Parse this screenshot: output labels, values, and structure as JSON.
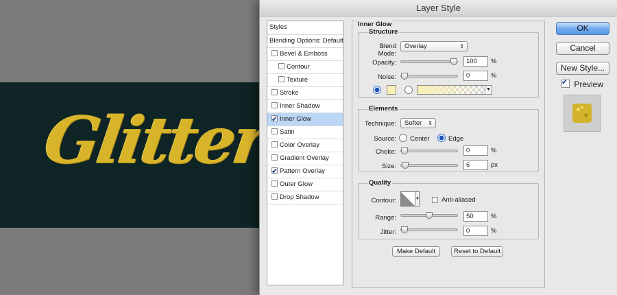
{
  "canvas": {
    "artwork_text": "Glitter",
    "doc_color": "#0f2424",
    "glitter_color": "#d8b42a"
  },
  "dialog": {
    "title": "Layer Style",
    "styles_panel": {
      "header": "Styles",
      "blending": "Blending Options: Default",
      "items": [
        {
          "label": "Bevel & Emboss",
          "checked": false,
          "sub": false,
          "selected": false
        },
        {
          "label": "Contour",
          "checked": false,
          "sub": true,
          "selected": false
        },
        {
          "label": "Texture",
          "checked": false,
          "sub": true,
          "selected": false
        },
        {
          "label": "Stroke",
          "checked": false,
          "sub": false,
          "selected": false
        },
        {
          "label": "Inner Shadow",
          "checked": false,
          "sub": false,
          "selected": false
        },
        {
          "label": "Inner Glow",
          "checked": true,
          "sub": false,
          "selected": true
        },
        {
          "label": "Satin",
          "checked": false,
          "sub": false,
          "selected": false
        },
        {
          "label": "Color Overlay",
          "checked": false,
          "sub": false,
          "selected": false
        },
        {
          "label": "Gradient Overlay",
          "checked": false,
          "sub": false,
          "selected": false
        },
        {
          "label": "Pattern Overlay",
          "checked": true,
          "sub": false,
          "selected": false
        },
        {
          "label": "Outer Glow",
          "checked": false,
          "sub": false,
          "selected": false
        },
        {
          "label": "Drop Shadow",
          "checked": false,
          "sub": false,
          "selected": false
        }
      ]
    },
    "inner_glow": {
      "title": "Inner Glow",
      "structure": {
        "title": "Structure",
        "blend_mode_label": "Blend Mode:",
        "blend_mode": "Overlay",
        "opacity_label": "Opacity:",
        "opacity": "100",
        "opacity_fraction": 1.0,
        "noise_label": "Noise:",
        "noise": "0",
        "noise_fraction": 0.0,
        "percent": "%",
        "glow_color": "#fbf1b6"
      },
      "elements": {
        "title": "Elements",
        "technique_label": "Technique:",
        "technique": "Softer",
        "source_label": "Source:",
        "source_center": "Center",
        "source_edge": "Edge",
        "choke_label": "Choke:",
        "choke": "0",
        "choke_fraction": 0.0,
        "size_label": "Size:",
        "size": "6",
        "size_fraction": 0.02,
        "percent": "%",
        "px": "px"
      },
      "quality": {
        "title": "Quality",
        "contour_label": "Contour:",
        "anti_aliased": "Anti-aliased",
        "range_label": "Range:",
        "range": "50",
        "range_fraction": 0.5,
        "jitter_label": "Jitter:",
        "jitter": "0",
        "jitter_fraction": 0.0,
        "percent": "%"
      },
      "make_default": "Make Default",
      "reset_default": "Reset to Default"
    },
    "buttons": {
      "ok": "OK",
      "cancel": "Cancel",
      "new_style": "New Style...",
      "preview": "Preview"
    }
  }
}
